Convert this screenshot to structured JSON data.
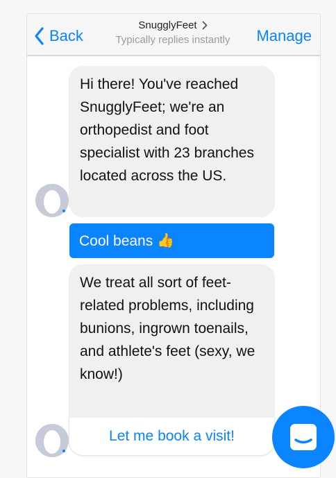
{
  "header": {
    "back_label": "Back",
    "name": "SnugglyFeet",
    "status": "Typically replies instantly",
    "manage_label": "Manage"
  },
  "messages": [
    {
      "from": "bot",
      "text": "Hi there! You've reached SnugglyFeet; we're an orthopedist and foot specialist with 23 branches located across the US."
    },
    {
      "from": "user",
      "text": "Cool beans",
      "emoji": "👍"
    },
    {
      "from": "bot",
      "text": "We treat all sort of feet-related problems, including bunions, ingrown toenails, and athlete's feet (sexy, we know!)"
    }
  ],
  "quick_reply": "Let me book a visit!",
  "colors": {
    "accent": "#0b84ff",
    "bubble_in": "#f0f0f0"
  },
  "icons": [
    "chevron-left-icon",
    "chevron-right-icon",
    "avatar-icon",
    "chat-launcher-icon"
  ]
}
